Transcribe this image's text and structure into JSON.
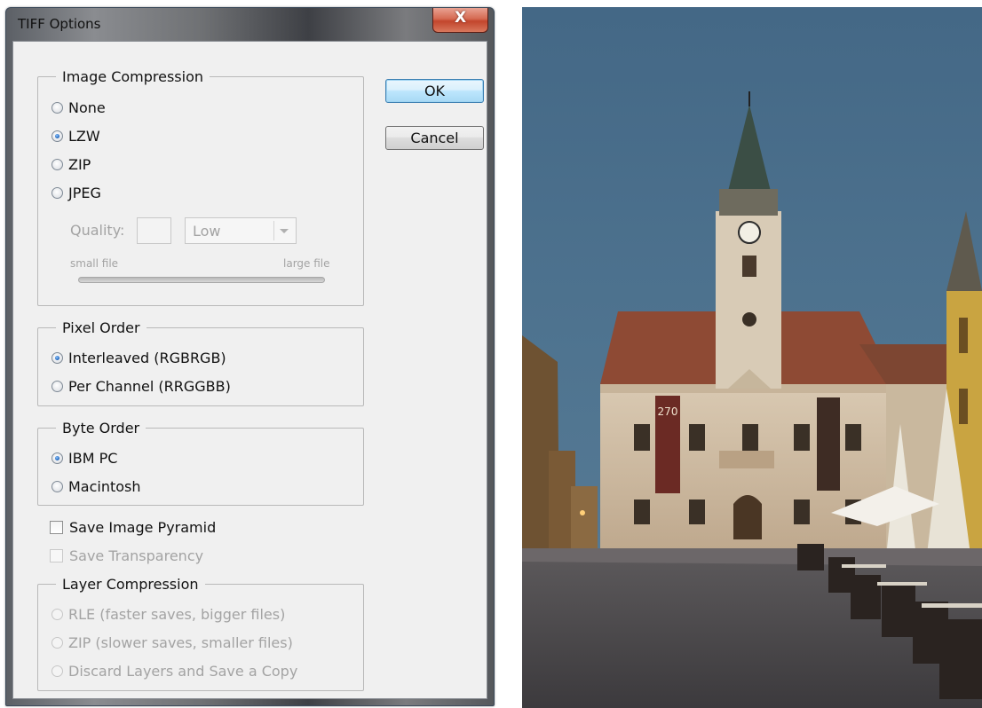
{
  "window": {
    "title": "TIFF Options",
    "close_glyph": "X"
  },
  "image_compression": {
    "legend": "Image Compression",
    "options": [
      {
        "label": "None",
        "selected": false
      },
      {
        "label": "LZW",
        "selected": true
      },
      {
        "label": "ZIP",
        "selected": false
      },
      {
        "label": "JPEG",
        "selected": false
      }
    ],
    "quality_label": "Quality:",
    "quality_value": "",
    "quality_select": "Low",
    "small_file_label": "small file",
    "large_file_label": "large file"
  },
  "pixel_order": {
    "legend": "Pixel Order",
    "options": [
      {
        "label": "Interleaved (RGBRGB)",
        "selected": true
      },
      {
        "label": "Per Channel (RRGGBB)",
        "selected": false
      }
    ]
  },
  "byte_order": {
    "legend": "Byte Order",
    "options": [
      {
        "label": "IBM PC",
        "selected": true
      },
      {
        "label": "Macintosh",
        "selected": false
      }
    ]
  },
  "checkboxes": {
    "save_image_pyramid": {
      "label": "Save Image Pyramid",
      "checked": false
    },
    "save_transparency": {
      "label": "Save Transparency",
      "checked": false,
      "disabled": true
    }
  },
  "layer_compression": {
    "legend": "Layer Compression",
    "options": [
      {
        "label": "RLE (faster saves, bigger files)",
        "selected": false
      },
      {
        "label": "ZIP (slower saves, smaller files)",
        "selected": false
      },
      {
        "label": "Discard Layers and Save a Copy",
        "selected": false
      }
    ]
  },
  "buttons": {
    "ok": "OK",
    "cancel": "Cancel"
  },
  "photo": {
    "clock_banner_text": "270"
  },
  "colors": {
    "accent": "#3c7fb1",
    "close_red": "#c2452c",
    "sky": "#4f7490"
  }
}
